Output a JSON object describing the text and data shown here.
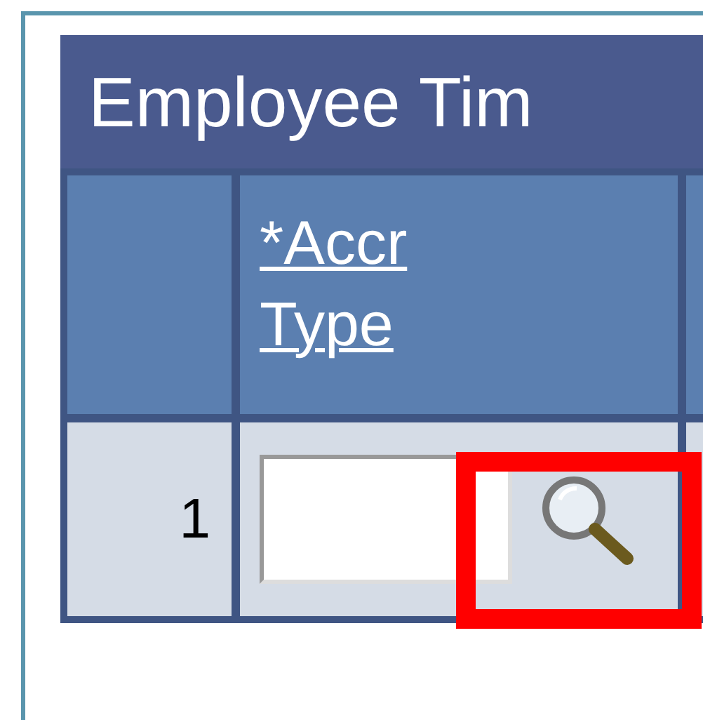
{
  "grid": {
    "title": "Employee Tim",
    "columns": [
      {},
      {
        "label": "*Accr Type"
      }
    ],
    "rows": [
      {
        "number": "1",
        "lookup_highlighted": true
      }
    ]
  }
}
